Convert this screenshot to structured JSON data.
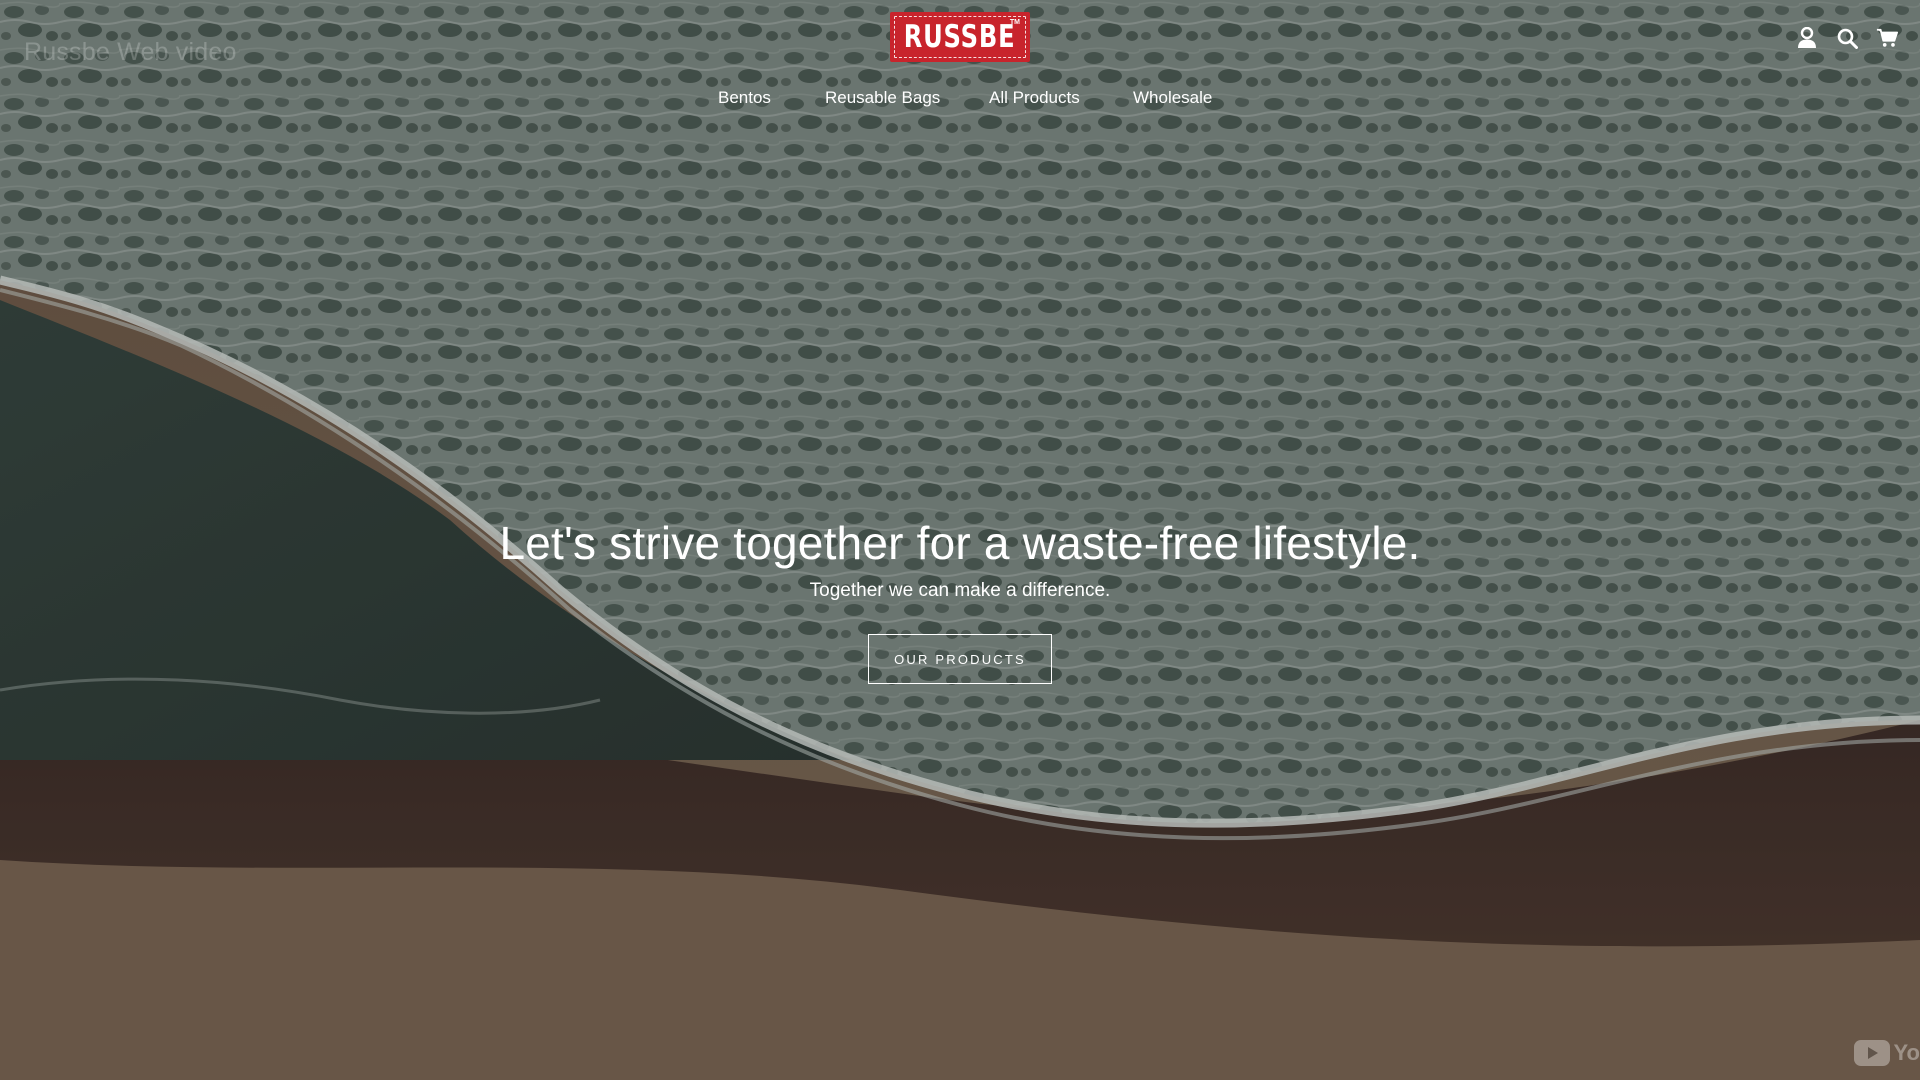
{
  "video_overlay": {
    "title": "Russbe Web video",
    "badge_text": "Yo"
  },
  "header": {
    "logo": {
      "text": "RUSSBE",
      "trademark": "TM",
      "color": "#c8242c"
    },
    "nav": [
      {
        "label": "Bentos"
      },
      {
        "label": "Reusable Bags"
      },
      {
        "label": "All Products"
      },
      {
        "label": "Wholesale"
      }
    ],
    "icons": [
      "account-icon",
      "search-icon",
      "cart-icon"
    ]
  },
  "hero": {
    "title": "Let's strive together for a waste-free lifestyle.",
    "subtitle": "Together we can make a difference.",
    "button_label": "OUR PRODUCTS"
  },
  "colors": {
    "text": "#ffffff",
    "sea": "#5f6e68",
    "sand": "#6e5b4a"
  }
}
